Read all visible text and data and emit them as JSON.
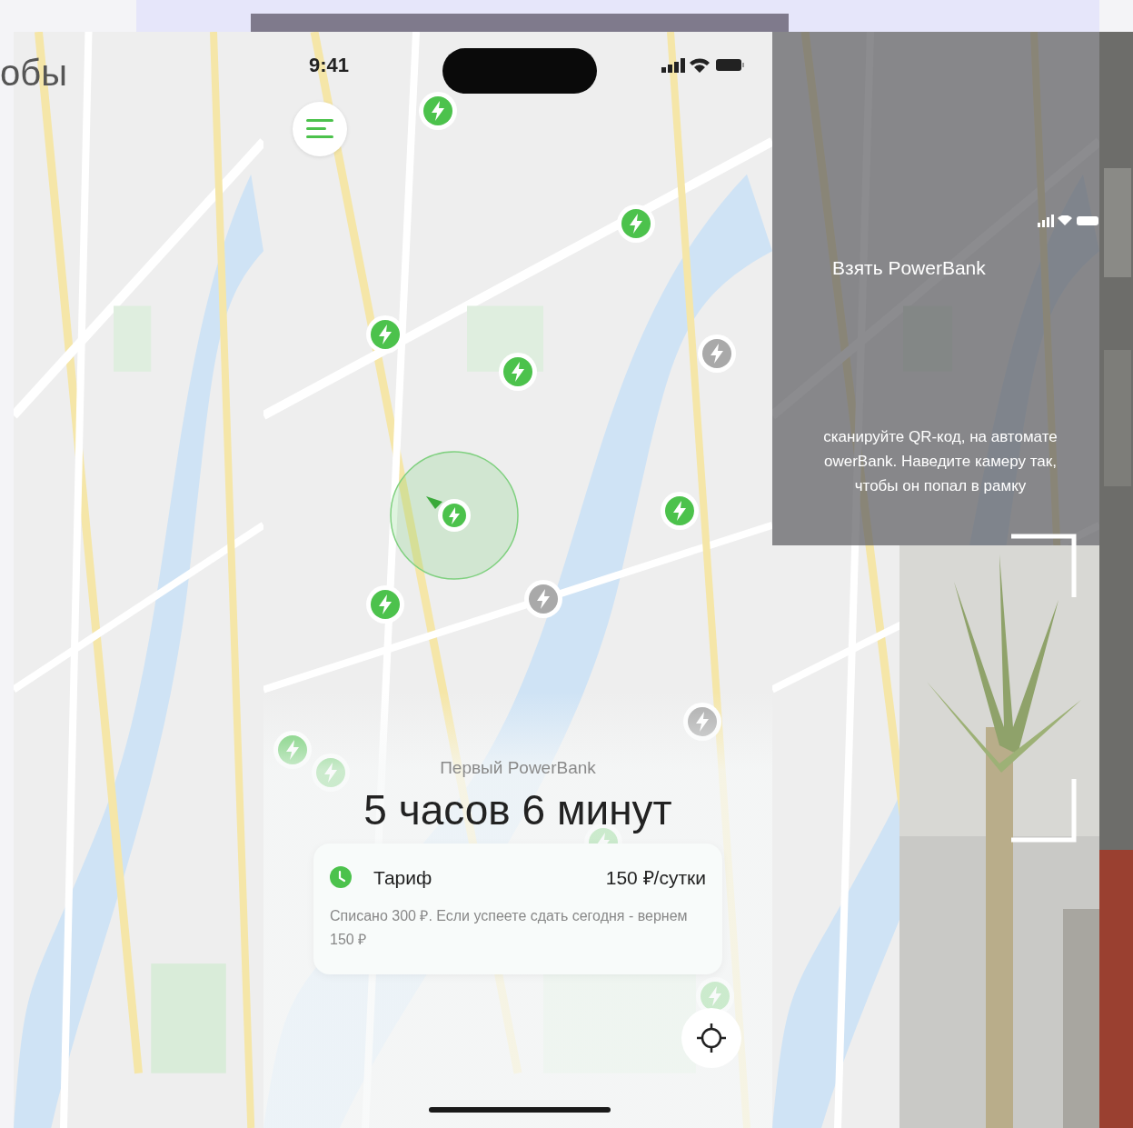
{
  "left_frame": {
    "heading": "обы"
  },
  "phone": {
    "status_bar": {
      "time": "9:41"
    },
    "markers": [
      {
        "available": true
      },
      {
        "available": true
      },
      {
        "available": true
      },
      {
        "available": true
      },
      {
        "available": true
      },
      {
        "available": true
      },
      {
        "available": true
      },
      {
        "available": true
      },
      {
        "available": true
      },
      {
        "available": true
      },
      {
        "available": false
      },
      {
        "available": false
      },
      {
        "available": false
      }
    ],
    "rental": {
      "subtitle": "Первый PowerBank",
      "duration": "5 часов 6 минут"
    },
    "tariff": {
      "label": "Тариф",
      "price": "150 ₽/сутки",
      "note": "Списано 300 ₽. Если успеете сдать сегодня - вернем 150 ₽"
    }
  },
  "right_frame": {
    "title": "Взять PowerBank",
    "instructions": [
      "сканируйте QR-код, на автомате",
      "owerBank. Наведите камеру так,",
      "чтобы он попал в рамку"
    ]
  }
}
